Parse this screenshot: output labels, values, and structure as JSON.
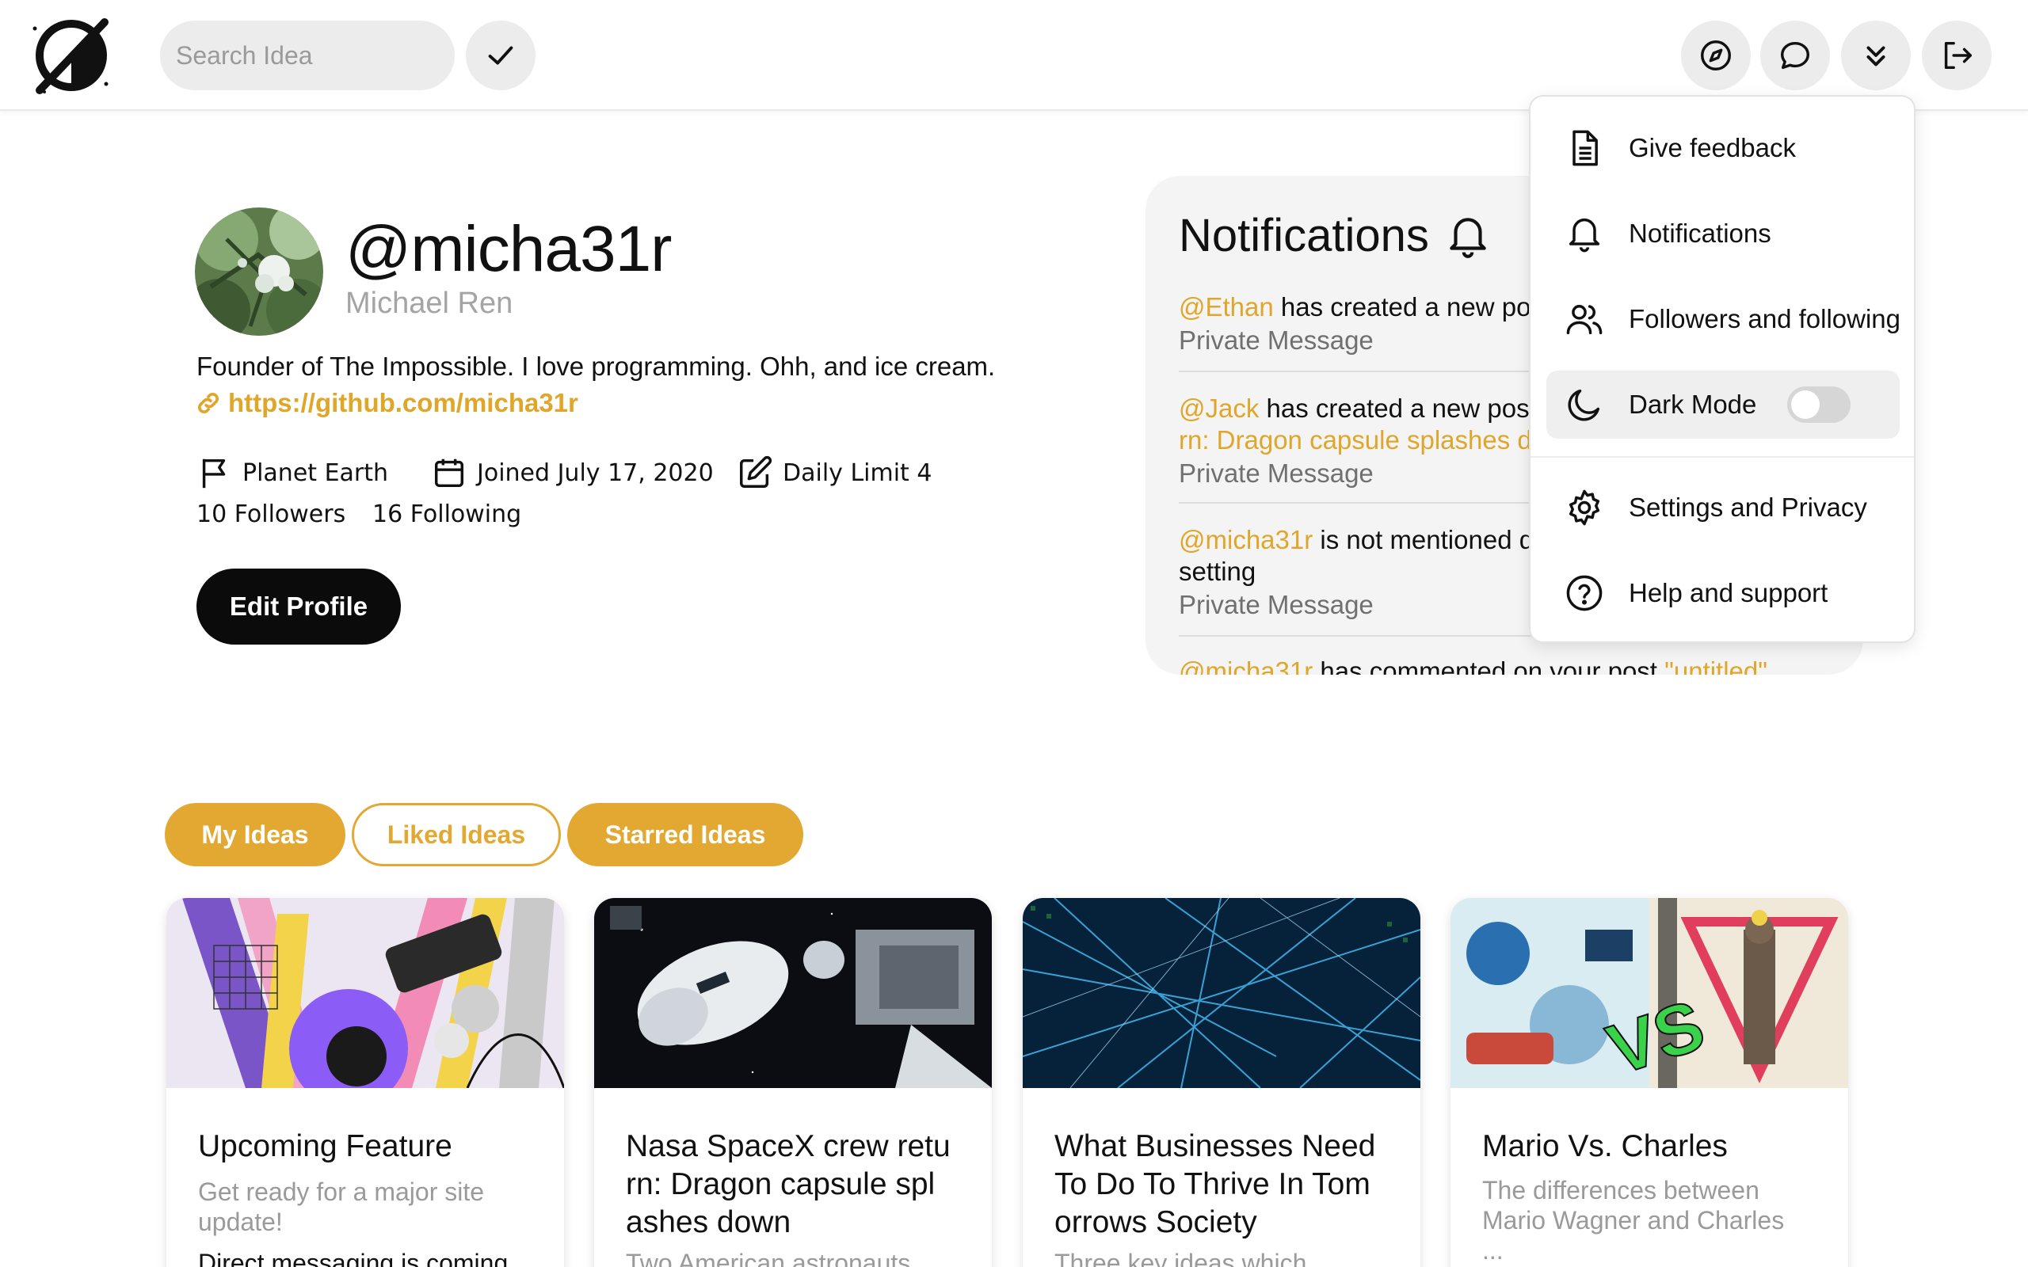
{
  "header": {
    "search_placeholder": "Search Idea"
  },
  "profile": {
    "handle": "@micha31r",
    "name": "Michael Ren",
    "bio": "Founder of The Impossible. I love programming. Ohh, and ice cream.",
    "link": "https://github.com/micha31r",
    "location": "Planet Earth",
    "joined": "Joined July 17, 2020",
    "daily_limit": "Daily Limit 4",
    "followers": "10 Followers",
    "following": "16 Following",
    "edit_label": "Edit Profile"
  },
  "notifications": {
    "title": "Notifications",
    "items": [
      {
        "user": "@Ethan",
        "text": " has created a new post",
        "sub": "Private Message"
      },
      {
        "user": "@Jack",
        "text": " has created a new post",
        "post_cont": "rn: Dragon capsule splashes down",
        "sub": "Private Message"
      },
      {
        "user": "@micha31r",
        "text": " is not mentioned due to privacy",
        "line2": "setting",
        "sub": "Private Message"
      },
      {
        "user": "@micha31r",
        "text": " has commented on your post ",
        "post": "\"untitled\""
      }
    ]
  },
  "menu": {
    "items": [
      {
        "label": "Give feedback",
        "icon": "document-icon"
      },
      {
        "label": "Notifications",
        "icon": "bell-icon"
      },
      {
        "label": "Followers and following",
        "icon": "users-icon"
      },
      {
        "label": "Dark Mode",
        "icon": "moon-icon"
      },
      {
        "label": "Settings and Privacy",
        "icon": "gear-icon"
      },
      {
        "label": "Help and support",
        "icon": "help-circle-icon"
      }
    ],
    "dark_mode_enabled": false
  },
  "tabs": [
    {
      "label": "My Ideas",
      "state": "filled"
    },
    {
      "label": "Liked Ideas",
      "state": "outline"
    },
    {
      "label": "Starred Ideas",
      "state": "filled"
    }
  ],
  "cards": [
    {
      "title": "Upcoming Feature",
      "desc": "Get ready for a major site update!",
      "desc_more": "Direct messaging is coming"
    },
    {
      "title": "Nasa SpaceX crew retu rn: Dragon capsule spl ashes down",
      "desc": "Two American astronauts"
    },
    {
      "title": "What Businesses Need To Do To Thrive In Tom orrows Society",
      "desc": "Three key ideas which"
    },
    {
      "title": "Mario Vs. Charles",
      "desc": "The differences between Mario Wagner and Charles",
      "desc_more": "..."
    }
  ],
  "colors": {
    "accent": "#e3a832",
    "link": "#e0a62a",
    "dark_button": "#0b0b0b"
  }
}
